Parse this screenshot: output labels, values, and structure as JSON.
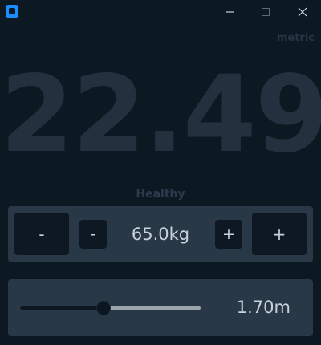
{
  "window": {
    "icon": "app-square-icon",
    "controls": [
      "minimize-icon",
      "maximize-icon",
      "close-icon"
    ]
  },
  "units_label": "metric",
  "bmi": {
    "value": "22.49",
    "category": "Healthy"
  },
  "weight": {
    "big_minus_label": "-",
    "small_minus_label": "-",
    "value": "65.0kg",
    "small_plus_label": "+",
    "big_plus_label": "+"
  },
  "height": {
    "value": "1.70m",
    "slider_fraction": 0.46
  },
  "colors": {
    "background": "#0c1822",
    "panel": "#293846",
    "button": "#0d1822",
    "bmi_text": "#24303d",
    "text": "#c8d2dc",
    "accent": "#1a8cff"
  }
}
